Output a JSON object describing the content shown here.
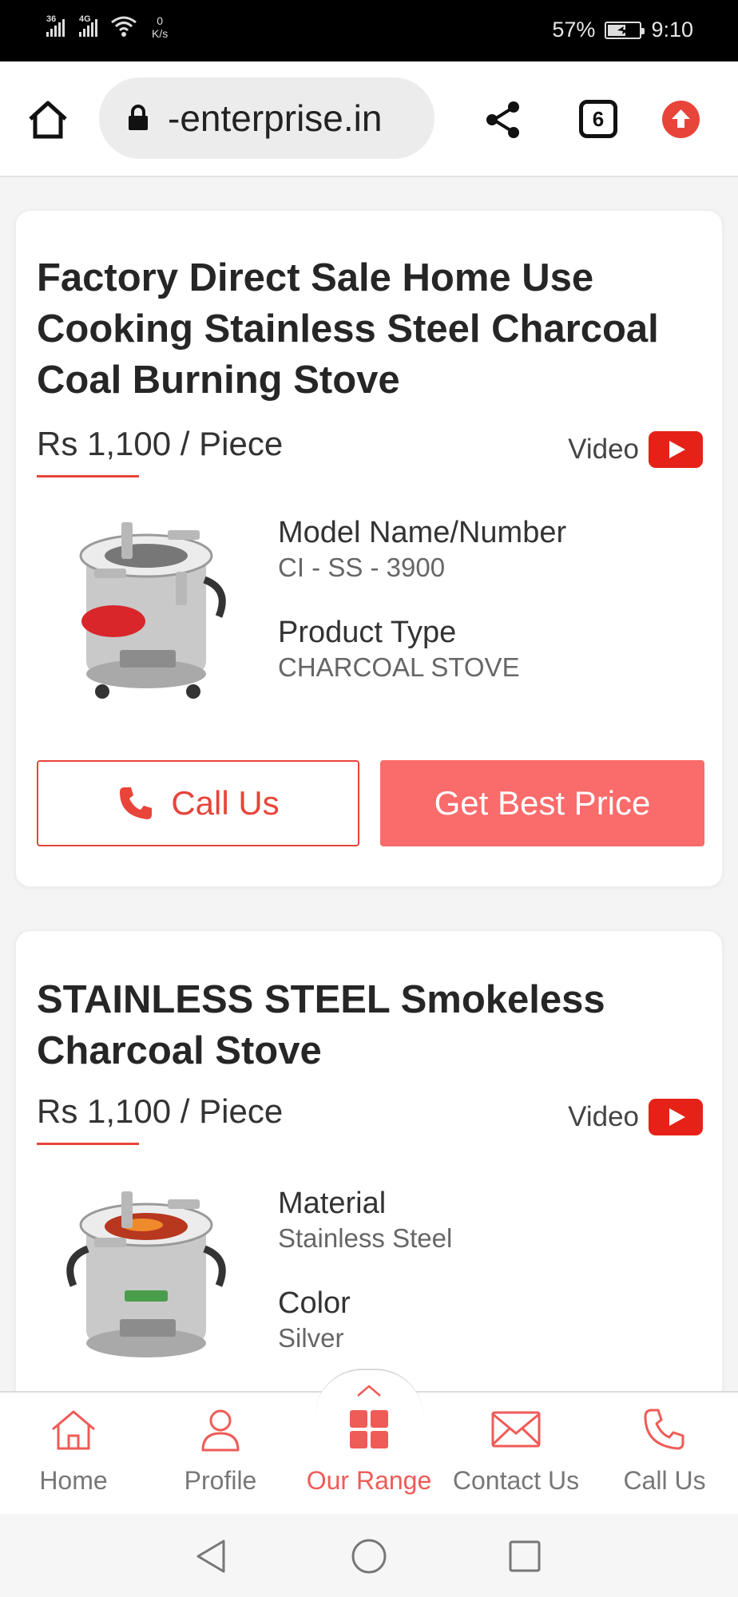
{
  "status_bar": {
    "signal1_label": "36",
    "signal2_label": "4G",
    "speed_value": "0",
    "speed_unit": "K/s",
    "battery_percent": "57%",
    "battery_level": 0.57,
    "time": "9:10"
  },
  "browser": {
    "url": "-enterprise.in",
    "tab_count": "6",
    "icons": [
      "home-icon",
      "lock-icon",
      "share-icon",
      "tabs-icon",
      "update-icon"
    ]
  },
  "products": [
    {
      "title": "Factory Direct Sale Home Use Cooking Stainless Steel Charcoal Coal Burning Stove",
      "price": "Rs 1,100 / Piece",
      "video_label": "Video",
      "specs": [
        {
          "label": "Model Name/Number",
          "value": "CI - SS - 3900"
        },
        {
          "label": "Product Type",
          "value": "CHARCOAL STOVE"
        }
      ],
      "call_label": "Call Us",
      "price_button_label": "Get Best Price"
    },
    {
      "title": "STAINLESS STEEL Smokeless Charcoal Stove",
      "price": "Rs 1,100 / Piece",
      "video_label": "Video",
      "specs": [
        {
          "label": "Material",
          "value": "Stainless Steel"
        },
        {
          "label": "Color",
          "value": "Silver"
        }
      ]
    }
  ],
  "bottom_nav": {
    "items": [
      {
        "label": "Home",
        "icon": "home-icon"
      },
      {
        "label": "Profile",
        "icon": "user-icon"
      },
      {
        "label": "Our Range",
        "icon": "grid-icon",
        "active": true
      },
      {
        "label": "Contact Us",
        "icon": "mail-icon"
      },
      {
        "label": "Call Us",
        "icon": "phone-icon"
      }
    ]
  },
  "colors": {
    "accent": "#e8443a",
    "button": "#fa6b6b",
    "active_nav": "#ef5b57",
    "youtube": "#e62117"
  }
}
